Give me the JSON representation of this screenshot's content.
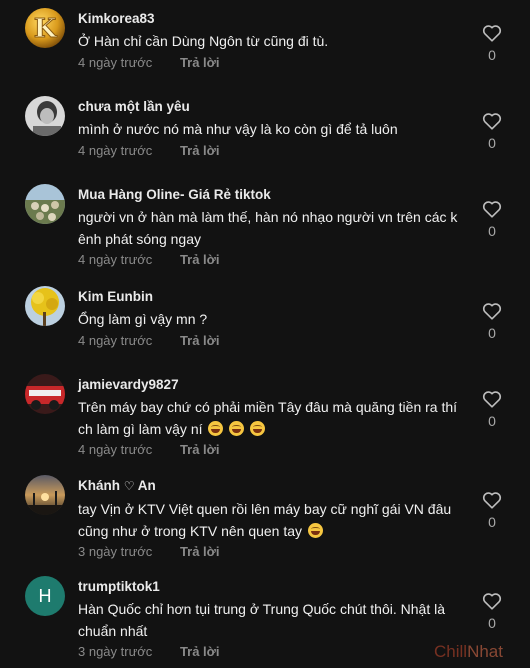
{
  "comments": [
    {
      "username": "Kimkorea83",
      "text": "Ở Hàn chỉ cần Dùng Ngôn từ cũng đi tù.",
      "time": "4 ngày trước",
      "reply": "Trả lời",
      "likes": "0",
      "avatar": "gold-letter-k"
    },
    {
      "username": "chưa một lần yêu",
      "text": "mình ở nước nó mà như vậy là ko còn gì để tả luôn",
      "time": "4 ngày trước",
      "reply": "Trả lời",
      "likes": "0",
      "avatar": "gray-portrait"
    },
    {
      "username": "Mua Hàng Oline- Giá Rẻ tiktok",
      "text_line1": "người vn ở hàn mà làm thế, hàn nó nhạo người vn trên các k",
      "text_line2": "ênh phát sóng ngay",
      "time": "4 ngày trước",
      "reply": "Trả lời",
      "likes": "0",
      "avatar": "outdoor-crowd"
    },
    {
      "username": "Kim Eunbin",
      "text": "Ổng làm gì vậy mn ?",
      "time": "4 ngày trước",
      "reply": "Trả lời",
      "likes": "0",
      "avatar": "yellow-tree"
    },
    {
      "username": "jamievardy9827",
      "text_line1": "Trên máy bay chứ có phải miền Tây đâu mà quăng tiền ra thí",
      "text_line2": "ch làm gì làm vậy ní",
      "time": "4 ngày trước",
      "reply": "Trả lời",
      "likes": "0",
      "avatar": "red-vehicle"
    },
    {
      "username_part1": "Khánh",
      "username_heart": "♡",
      "username_part2": "An",
      "text_line1": "tay Vịn ở KTV Việt quen rồi lên máy bay cữ nghĩ gái VN đâu",
      "text_line2": "cũng như ở trong KTV nên quen tay",
      "time": "3 ngày trước",
      "reply": "Trả lời",
      "likes": "0",
      "avatar": "sunset-silhouette"
    },
    {
      "username": "trumptiktok1",
      "text_line1": "Hàn Quốc chỉ hơn tụi trung ở Trung Quốc chút thôi. Nhật là",
      "text_line2": "chuẩn nhất",
      "time": "3 ngày trước",
      "reply": "Trả lời",
      "likes": "0",
      "avatar_letter": "H",
      "avatar_color": "#1e7b6e"
    }
  ],
  "watermark_part1": "Chill",
  "watermark_part2": "Nhat"
}
